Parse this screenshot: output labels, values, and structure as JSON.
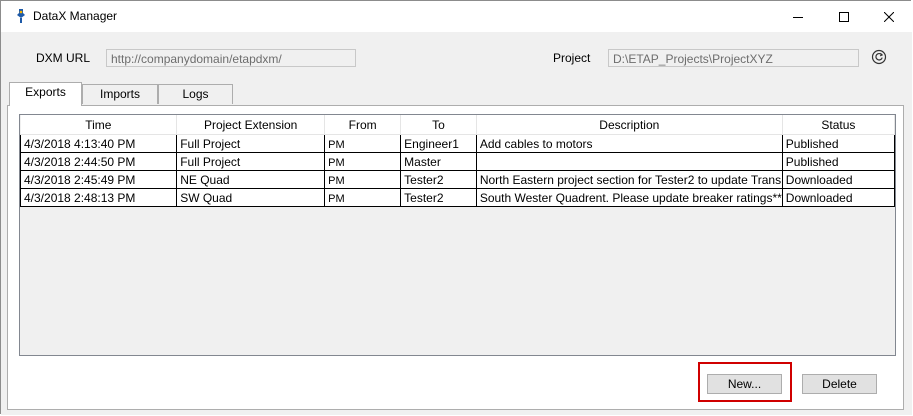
{
  "window": {
    "title": "DataX Manager",
    "minimize_icon": "minimize-icon",
    "maximize_icon": "maximize-icon",
    "close_icon": "close-icon"
  },
  "header": {
    "dxm_url_label": "DXM URL",
    "dxm_url_value": "http://companydomain/etapdxm/",
    "project_label": "Project",
    "project_value": "D:\\ETAP_Projects\\ProjectXYZ",
    "refresh_icon": "refresh-icon"
  },
  "tabs": [
    {
      "label": "Exports",
      "active": true
    },
    {
      "label": "Imports",
      "active": false
    },
    {
      "label": "Logs",
      "active": false
    }
  ],
  "exports_table": {
    "columns": [
      "Time",
      "Project Extension",
      "From",
      "To",
      "Description",
      "Status"
    ],
    "rows": [
      [
        "4/3/2018 4:13:40 PM",
        "Full Project",
        "PM",
        "Engineer1",
        "Add cables to motors",
        "Published"
      ],
      [
        "4/3/2018 2:44:50 PM",
        "Full Project",
        "PM",
        "Master",
        "",
        "Published"
      ],
      [
        "4/3/2018 2:45:49 PM",
        "NE Quad",
        "PM",
        "Tester2",
        "North Eastern project section for Tester2 to update Trans",
        "Downloaded"
      ],
      [
        "4/3/2018 2:48:13 PM",
        "SW Quad",
        "PM",
        "Tester2",
        "South Wester Quadrent. Please update breaker ratings**",
        "Downloaded"
      ]
    ]
  },
  "actions": {
    "new_label": "New...",
    "delete_label": "Delete"
  },
  "colors": {
    "highlight": "#d00000",
    "window_bg": "#f0f0f0"
  }
}
